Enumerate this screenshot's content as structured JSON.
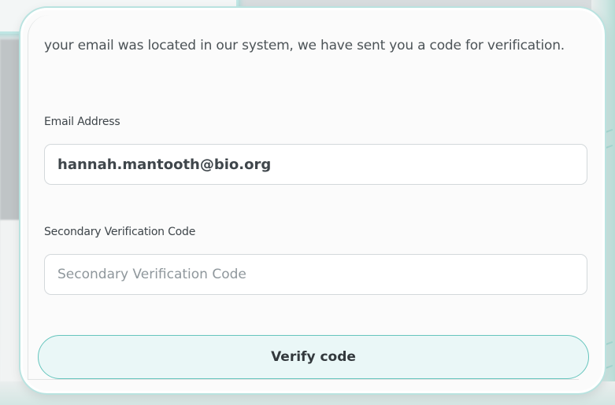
{
  "verification": {
    "intro_text": "your email was located in our system, we have sent you a code for verification.",
    "email_label": "Email Address",
    "email_value": "hannah.mantooth@bio.org",
    "code_label": "Secondary Verification Code",
    "code_value": "",
    "code_placeholder": "Secondary Verification Code",
    "verify_button_label": "Verify code"
  },
  "colors": {
    "accent": "#66c5bd",
    "button_fill": "#eaf7f7",
    "text": "#3d4449"
  }
}
